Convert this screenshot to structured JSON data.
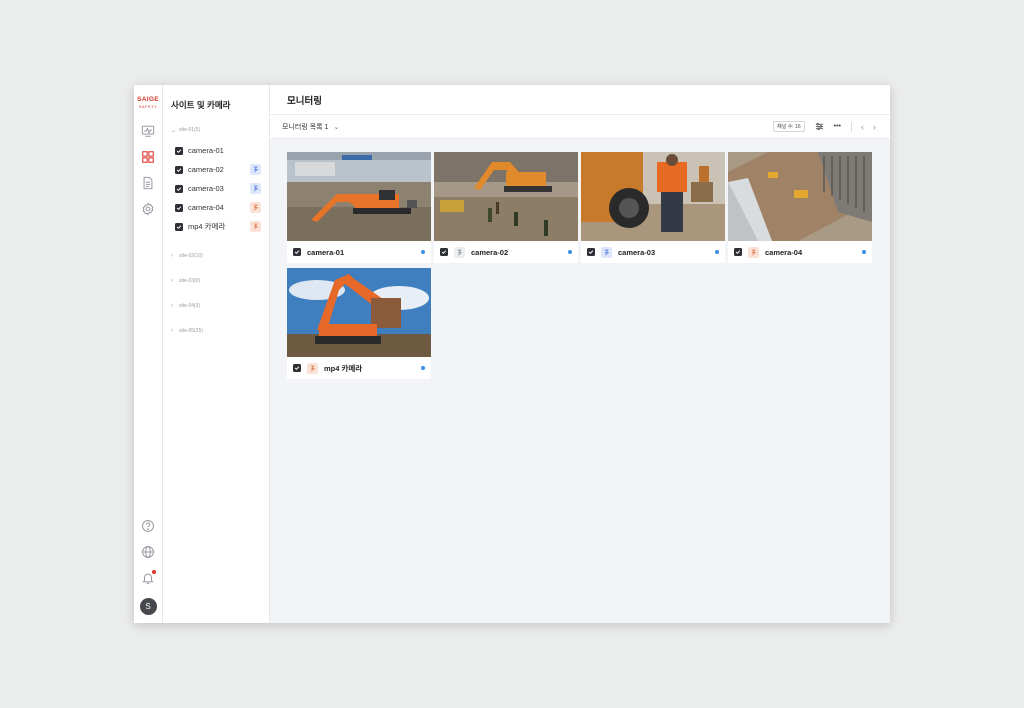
{
  "brand": {
    "line1": "SAIGE",
    "line2": "SAFETY"
  },
  "rail": {
    "nav": [
      {
        "icon": "monitor-icon"
      },
      {
        "icon": "grid-icon"
      },
      {
        "icon": "document-icon"
      },
      {
        "icon": "gear-icon"
      }
    ],
    "bottom": [
      {
        "icon": "help-icon"
      },
      {
        "icon": "globe-icon"
      },
      {
        "icon": "bell-icon"
      }
    ],
    "avatar_initial": "S"
  },
  "sidebar": {
    "title": "사이트 및 카메라",
    "sites": [
      {
        "label": "site-01(5)",
        "expanded": true
      },
      {
        "label": "site-02(10)",
        "expanded": false
      },
      {
        "label": "site-03(0)",
        "expanded": false
      },
      {
        "label": "site-04(3)",
        "expanded": false
      },
      {
        "label": "site-05(25)",
        "expanded": false
      }
    ],
    "cameras": [
      {
        "label": "camera-01",
        "badge": "none",
        "checked": true
      },
      {
        "label": "camera-02",
        "badge": "blue",
        "checked": true
      },
      {
        "label": "camera-03",
        "badge": "blue",
        "checked": true
      },
      {
        "label": "camera-04",
        "badge": "orange",
        "checked": true
      },
      {
        "label": "mp4 카메라",
        "badge": "orange",
        "checked": true
      }
    ]
  },
  "header": {
    "title": "모니터링"
  },
  "toolbar": {
    "list_name": "모니터링 목록 1",
    "channel_count": "채널 수: 16",
    "more_icon": "more-icon",
    "filter_icon": "sliders-icon"
  },
  "tiles": [
    {
      "name": "camera-01",
      "badge": "none",
      "live": true
    },
    {
      "name": "camera-02",
      "badge": "gray",
      "live": true
    },
    {
      "name": "camera-03",
      "badge": "blue",
      "live": true
    },
    {
      "name": "camera-04",
      "badge": "orange",
      "live": true
    },
    {
      "name": "mp4 카메라",
      "badge": "orange",
      "live": true
    }
  ],
  "colors": {
    "accent": "#d9342b",
    "live": "#3b8ee6",
    "excavator": "#e8742a"
  }
}
